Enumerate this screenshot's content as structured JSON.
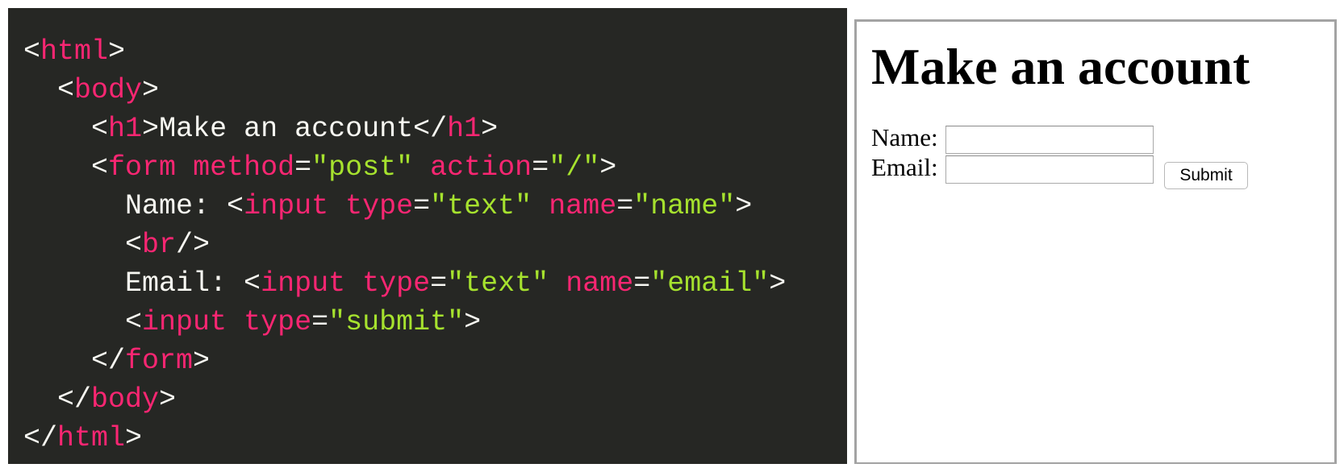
{
  "code": {
    "lines": [
      [
        {
          "c": "punct",
          "t": "<"
        },
        {
          "c": "tag",
          "t": "html"
        },
        {
          "c": "punct",
          "t": ">"
        }
      ],
      [
        {
          "c": "punct",
          "t": "  <"
        },
        {
          "c": "tag",
          "t": "body"
        },
        {
          "c": "punct",
          "t": ">"
        }
      ],
      [
        {
          "c": "punct",
          "t": "    <"
        },
        {
          "c": "tag",
          "t": "h1"
        },
        {
          "c": "punct",
          "t": ">"
        },
        {
          "c": "txt",
          "t": "Make an account"
        },
        {
          "c": "punct",
          "t": "</"
        },
        {
          "c": "tag",
          "t": "h1"
        },
        {
          "c": "punct",
          "t": ">"
        }
      ],
      [
        {
          "c": "punct",
          "t": "    <"
        },
        {
          "c": "tag",
          "t": "form"
        },
        {
          "c": "punct",
          "t": " "
        },
        {
          "c": "attr",
          "t": "method"
        },
        {
          "c": "punct",
          "t": "="
        },
        {
          "c": "str",
          "t": "\"post\""
        },
        {
          "c": "punct",
          "t": " "
        },
        {
          "c": "attr",
          "t": "action"
        },
        {
          "c": "punct",
          "t": "="
        },
        {
          "c": "str",
          "t": "\"/\""
        },
        {
          "c": "punct",
          "t": ">"
        }
      ],
      [
        {
          "c": "txt",
          "t": "      Name: "
        },
        {
          "c": "punct",
          "t": "<"
        },
        {
          "c": "tag",
          "t": "input"
        },
        {
          "c": "punct",
          "t": " "
        },
        {
          "c": "attr",
          "t": "type"
        },
        {
          "c": "punct",
          "t": "="
        },
        {
          "c": "str",
          "t": "\"text\""
        },
        {
          "c": "punct",
          "t": " "
        },
        {
          "c": "attr",
          "t": "name"
        },
        {
          "c": "punct",
          "t": "="
        },
        {
          "c": "str",
          "t": "\"name\""
        },
        {
          "c": "punct",
          "t": ">"
        }
      ],
      [
        {
          "c": "punct",
          "t": "      <"
        },
        {
          "c": "tag",
          "t": "br"
        },
        {
          "c": "punct",
          "t": "/>"
        }
      ],
      [
        {
          "c": "txt",
          "t": "      Email: "
        },
        {
          "c": "punct",
          "t": "<"
        },
        {
          "c": "tag",
          "t": "input"
        },
        {
          "c": "punct",
          "t": " "
        },
        {
          "c": "attr",
          "t": "type"
        },
        {
          "c": "punct",
          "t": "="
        },
        {
          "c": "str",
          "t": "\"text\""
        },
        {
          "c": "punct",
          "t": " "
        },
        {
          "c": "attr",
          "t": "name"
        },
        {
          "c": "punct",
          "t": "="
        },
        {
          "c": "str",
          "t": "\"email\""
        },
        {
          "c": "punct",
          "t": ">"
        }
      ],
      [
        {
          "c": "punct",
          "t": "      <"
        },
        {
          "c": "tag",
          "t": "input"
        },
        {
          "c": "punct",
          "t": " "
        },
        {
          "c": "attr",
          "t": "type"
        },
        {
          "c": "punct",
          "t": "="
        },
        {
          "c": "str",
          "t": "\"submit\""
        },
        {
          "c": "punct",
          "t": ">"
        }
      ],
      [
        {
          "c": "punct",
          "t": "    </"
        },
        {
          "c": "tag",
          "t": "form"
        },
        {
          "c": "punct",
          "t": ">"
        }
      ],
      [
        {
          "c": "punct",
          "t": "  </"
        },
        {
          "c": "tag",
          "t": "body"
        },
        {
          "c": "punct",
          "t": ">"
        }
      ],
      [
        {
          "c": "punct",
          "t": "</"
        },
        {
          "c": "tag",
          "t": "html"
        },
        {
          "c": "punct",
          "t": ">"
        }
      ]
    ]
  },
  "preview": {
    "title": "Make an account",
    "name_label": "Name:",
    "email_label": "Email:",
    "name_value": "",
    "email_value": "",
    "submit_label": "Submit"
  },
  "colors": {
    "code_background": "#262724",
    "tag": "#f92672",
    "string": "#a6e22e",
    "text": "#f8f8f2"
  }
}
